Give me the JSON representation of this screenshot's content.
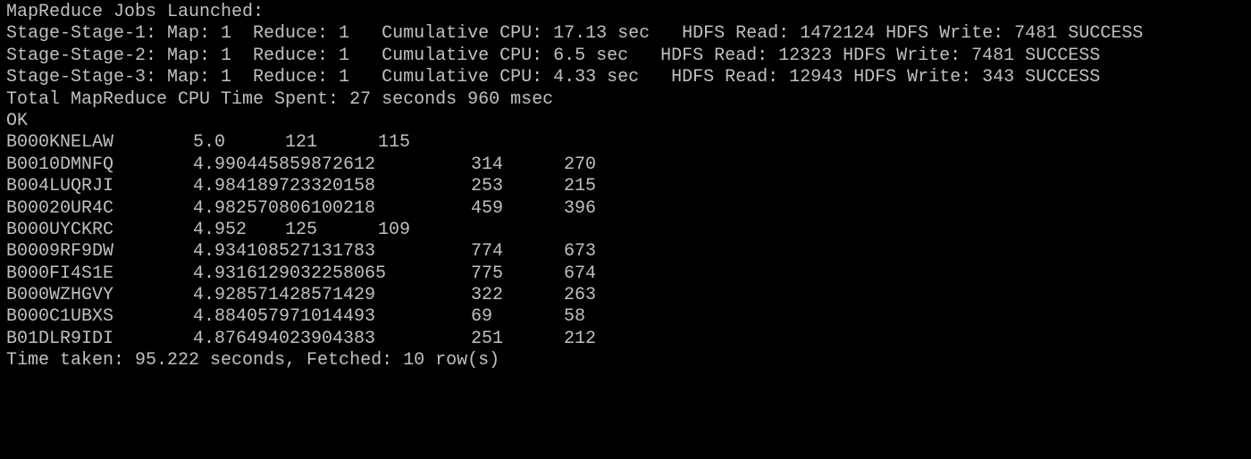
{
  "terminal": {
    "header_lines": [
      "MapReduce Jobs Launched:",
      "Stage-Stage-1: Map: 1  Reduce: 1   Cumulative CPU: 17.13 sec   HDFS Read: 1472124 HDFS Write: 7481 SUCCESS",
      "Stage-Stage-2: Map: 1  Reduce: 1   Cumulative CPU: 6.5 sec   HDFS Read: 12323 HDFS Write: 7481 SUCCESS",
      "Stage-Stage-3: Map: 1  Reduce: 1   Cumulative CPU: 4.33 sec   HDFS Read: 12943 HDFS Write: 343 SUCCESS",
      "Total MapReduce CPU Time Spent: 27 seconds 960 msec",
      "OK"
    ],
    "rows": [
      {
        "id": "B000KNELAW",
        "score": "5.0",
        "a": "121",
        "b": "115"
      },
      {
        "id": "B0010DMNFQ",
        "score": "4.990445859872612",
        "a": "314",
        "b": "270"
      },
      {
        "id": "B004LUQRJI",
        "score": "4.984189723320158",
        "a": "253",
        "b": "215"
      },
      {
        "id": "B00020UR4C",
        "score": "4.982570806100218",
        "a": "459",
        "b": "396"
      },
      {
        "id": "B000UYCKRC",
        "score": "4.952",
        "a": "125",
        "b": "109"
      },
      {
        "id": "B0009RF9DW",
        "score": "4.934108527131783",
        "a": "774",
        "b": "673"
      },
      {
        "id": "B000FI4S1E",
        "score": "4.9316129032258065",
        "a": "775",
        "b": "674"
      },
      {
        "id": "B000WZHGVY",
        "score": "4.928571428571429",
        "a": "322",
        "b": "263"
      },
      {
        "id": "B000C1UBXS",
        "score": "4.884057971014493",
        "a": "69",
        "b": "58"
      },
      {
        "id": "B01DLR9IDI",
        "score": "4.876494023904383",
        "a": "251",
        "b": "212"
      }
    ],
    "footer": "Time taken: 95.222 seconds, Fetched: 10 row(s)",
    "colors": {
      "background": "#000000",
      "text": "#c0c0c0"
    }
  }
}
